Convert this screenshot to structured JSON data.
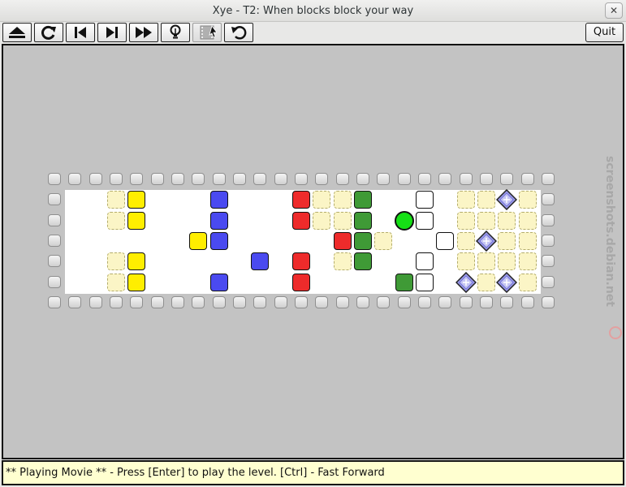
{
  "window": {
    "title": "Xye - T2: When blocks block your way",
    "close_icon": "close-icon"
  },
  "toolbar": {
    "buttons": [
      {
        "name": "eject-button",
        "icon": "eject-icon"
      },
      {
        "name": "restart-button",
        "icon": "restart-icon"
      },
      {
        "name": "previous-level-button",
        "icon": "skip-previous-icon"
      },
      {
        "name": "next-level-button",
        "icon": "skip-next-icon"
      },
      {
        "name": "fast-forward-button",
        "icon": "fast-forward-icon"
      },
      {
        "name": "hint-button",
        "icon": "lightbulb-icon"
      },
      {
        "name": "movie-button",
        "icon": "film-icon",
        "disabled": true
      },
      {
        "name": "undo-button",
        "icon": "undo-icon"
      }
    ],
    "quit_label": "Quit"
  },
  "board": {
    "cols": 25,
    "rows": 7,
    "floor_color": "#ffffff",
    "background_color": "#c3c3c3",
    "colors": {
      "yellow": "#ffee00",
      "blue": "#4a4af0",
      "red": "#ee2b2b",
      "green": "#3f9a36",
      "white": "#ffffff",
      "marker": "#fbf5c6",
      "player": "#16e016",
      "gem": "#9a9ae8"
    },
    "blocks": [
      {
        "color": "yellow",
        "col": 4,
        "row": 1
      },
      {
        "color": "yellow",
        "col": 4,
        "row": 2
      },
      {
        "color": "yellow",
        "col": 4,
        "row": 4
      },
      {
        "color": "yellow",
        "col": 4,
        "row": 5
      },
      {
        "color": "yellow",
        "col": 7,
        "row": 3
      },
      {
        "color": "blue",
        "col": 8,
        "row": 1
      },
      {
        "color": "blue",
        "col": 8,
        "row": 2
      },
      {
        "color": "blue",
        "col": 8,
        "row": 3
      },
      {
        "color": "blue",
        "col": 8,
        "row": 5
      },
      {
        "color": "blue",
        "col": 10,
        "row": 4
      },
      {
        "color": "red",
        "col": 12,
        "row": 1
      },
      {
        "color": "red",
        "col": 12,
        "row": 2
      },
      {
        "color": "red",
        "col": 12,
        "row": 4
      },
      {
        "color": "red",
        "col": 12,
        "row": 5
      },
      {
        "color": "red",
        "col": 14,
        "row": 3
      },
      {
        "color": "green",
        "col": 15,
        "row": 1
      },
      {
        "color": "green",
        "col": 15,
        "row": 2
      },
      {
        "color": "green",
        "col": 15,
        "row": 3
      },
      {
        "color": "green",
        "col": 15,
        "row": 4
      },
      {
        "color": "green",
        "col": 17,
        "row": 5
      },
      {
        "color": "white",
        "col": 18,
        "row": 1
      },
      {
        "color": "white",
        "col": 18,
        "row": 2
      },
      {
        "color": "white",
        "col": 19,
        "row": 3
      },
      {
        "color": "white",
        "col": 18,
        "row": 4
      },
      {
        "color": "white",
        "col": 18,
        "row": 5
      }
    ],
    "markers": [
      {
        "col": 3,
        "row": 1
      },
      {
        "col": 3,
        "row": 2
      },
      {
        "col": 3,
        "row": 4
      },
      {
        "col": 3,
        "row": 5
      },
      {
        "col": 13,
        "row": 1
      },
      {
        "col": 14,
        "row": 1
      },
      {
        "col": 13,
        "row": 2
      },
      {
        "col": 14,
        "row": 2
      },
      {
        "col": 16,
        "row": 3
      },
      {
        "col": 14,
        "row": 4
      },
      {
        "col": 20,
        "row": 1
      },
      {
        "col": 21,
        "row": 1
      },
      {
        "col": 23,
        "row": 1
      },
      {
        "col": 20,
        "row": 2
      },
      {
        "col": 21,
        "row": 2
      },
      {
        "col": 22,
        "row": 2
      },
      {
        "col": 23,
        "row": 2
      },
      {
        "col": 20,
        "row": 3
      },
      {
        "col": 22,
        "row": 3
      },
      {
        "col": 23,
        "row": 3
      },
      {
        "col": 20,
        "row": 4
      },
      {
        "col": 21,
        "row": 4
      },
      {
        "col": 22,
        "row": 4
      },
      {
        "col": 23,
        "row": 4
      },
      {
        "col": 21,
        "row": 5
      },
      {
        "col": 23,
        "row": 5
      }
    ],
    "gems": [
      {
        "col": 22,
        "row": 1
      },
      {
        "col": 21,
        "row": 3
      },
      {
        "col": 20,
        "row": 5
      },
      {
        "col": 22,
        "row": 5
      }
    ],
    "player": {
      "col": 17,
      "row": 2
    }
  },
  "watermark": {
    "text": "screenshots.debian.net"
  },
  "status": {
    "text": "** Playing Movie ** - Press [Enter] to play the level. [Ctrl] - Fast Forward"
  }
}
